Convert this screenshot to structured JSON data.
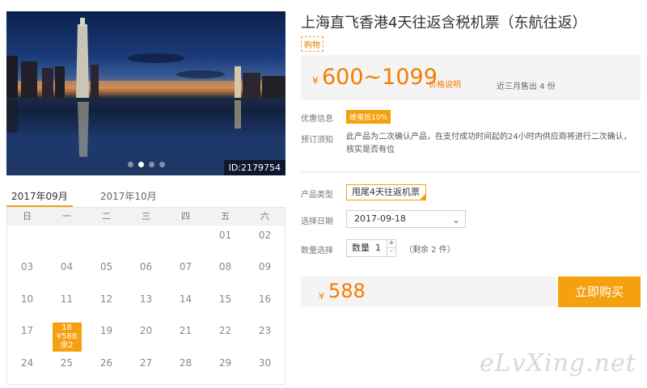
{
  "product": {
    "title": "上海直飞香港4天往返含税机票（东航往返）",
    "tag": "购物",
    "price_yen": "¥",
    "price_range": "600~1099",
    "price_note": "价格说明",
    "sold": "近三月售出 4 份"
  },
  "photo": {
    "id_label": "ID:2179754",
    "dots": 4,
    "active_dot": 1
  },
  "info": {
    "promo_label": "优惠信息",
    "promo_badge": "蜂蜜抵10%",
    "notice_label": "预订须知",
    "notice_text": "此产品为二次确认产品，在支付成功时间起的24小时内供应商将进行二次确认，核实是否有位"
  },
  "options": {
    "product_type_label": "产品类型",
    "product_type_value": "甩尾4天往返机票",
    "date_label": "选择日期",
    "date_value": "2017-09-18",
    "qty_label": "数量选择",
    "qty_prefix": "数量",
    "qty_value": "1",
    "qty_plus": "+",
    "qty_minus": "-",
    "remain": "（剩余 2 件）"
  },
  "buy": {
    "yen": "¥",
    "price": "588",
    "button_label": "立即购买"
  },
  "calendar": {
    "tabs": [
      "2017年09月",
      "2017年10月"
    ],
    "weekdays": [
      "日",
      "一",
      "二",
      "三",
      "四",
      "五",
      "六"
    ],
    "weeks": [
      [
        "",
        "",
        "",
        "",
        "",
        "01",
        "02"
      ],
      [
        "03",
        "04",
        "05",
        "06",
        "07",
        "08",
        "09"
      ],
      [
        "10",
        "11",
        "12",
        "13",
        "14",
        "15",
        "16"
      ],
      [
        "17",
        "18",
        "19",
        "20",
        "21",
        "22",
        "23"
      ],
      [
        "24",
        "25",
        "26",
        "27",
        "28",
        "29",
        "30"
      ]
    ],
    "selected": {
      "day": "18",
      "price": "¥588",
      "remain": "余2"
    }
  },
  "watermark": "eLvXing.net",
  "colors": {
    "accent": "#f5a00f",
    "price": "#f57c00"
  }
}
